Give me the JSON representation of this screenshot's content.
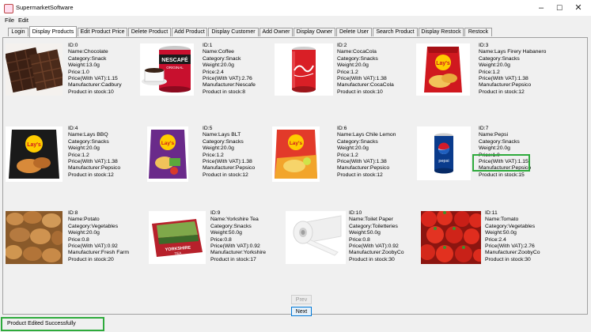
{
  "window": {
    "title": "SupermarketSoftware",
    "minimize_glyph": "–",
    "maximize_glyph": "☐",
    "close_glyph": "✕"
  },
  "menu": [
    "File",
    "Edit"
  ],
  "tabs": [
    {
      "label": "Login"
    },
    {
      "label": "Display Products",
      "active": true
    },
    {
      "label": "Edit Product Price"
    },
    {
      "label": "Delete Product"
    },
    {
      "label": "Add Product"
    },
    {
      "label": "Display Customer"
    },
    {
      "label": "Add Owner"
    },
    {
      "label": "Display Owner"
    },
    {
      "label": "Delete User"
    },
    {
      "label": "Search Product"
    },
    {
      "label": "Display Restock"
    },
    {
      "label": "Restock"
    }
  ],
  "products": [
    {
      "image": "chocolate",
      "lines": [
        "ID:0",
        "Name:Chocolate",
        "Category:Snack",
        "Weight:13.0g",
        "Price:1.0",
        "Price(With VAT):1.15",
        "Manufacturer:Cadbury",
        "Product in stock:10"
      ]
    },
    {
      "image": "coffee",
      "lines": [
        "ID:1",
        "Name:Coffee",
        "Category:Snack",
        "Weight:20.0g",
        "Price:2.4",
        "Price(With VAT):2.76",
        "Manufacturer:Nescafe",
        "Product in stock:8"
      ]
    },
    {
      "image": "cocacola",
      "lines": [
        "ID:2",
        "Name:CocaCola",
        "Category:Snacks",
        "Weight:20.0g",
        "Price:1.2",
        "Price(With VAT):1.38",
        "Manufacturer:CocaCola",
        "Product in stock:10"
      ]
    },
    {
      "image": "lays-red",
      "lines": [
        "ID:3",
        "Name:Lays Firery Habanero",
        "Category:Snacks",
        "Weight:20.0g",
        "Price:1.2",
        "Price(With VAT):1.38",
        "Manufacturer:Pepsico",
        "Product in stock:12"
      ]
    },
    {
      "image": "lays-bbq",
      "lines": [
        "ID:4",
        "Name:Lays BBQ",
        "Category:Snacks",
        "Weight:20.0g",
        "Price:1.2",
        "Price(With VAT):1.38",
        "Manufacturer:Pepsico",
        "Product in stock:12"
      ]
    },
    {
      "image": "lays-blt",
      "lines": [
        "ID:5",
        "Name:Lays BLT",
        "Category:Snacks",
        "Weight:20.0g",
        "Price:1.2",
        "Price(With VAT):1.38",
        "Manufacturer:Pepsico",
        "Product in stock:12"
      ]
    },
    {
      "image": "lays-chile",
      "lines": [
        "ID:6",
        "Name:Lays Chile Lemon",
        "Category:Snacks",
        "Weight:20.0g",
        "Price:1.2",
        "Price(With VAT):1.38",
        "Manufacturer:Pepsico",
        "Product in stock:12"
      ]
    },
    {
      "image": "pepsi",
      "lines": [
        "ID:7",
        "Name:Pepsi",
        "Category:Snacks",
        "Weight:20.0g",
        "Price:1.0",
        "Price(With VAT):1.15",
        "Manufacturer:Pepsico",
        "Product in stock:15"
      ]
    },
    {
      "image": "potato",
      "lines": [
        "ID:8",
        "Name:Potato",
        "Category:Vegetables",
        "Weight:20.0g",
        "Price:0.8",
        "Price(With VAT):0.92",
        "Manufacturer:Fresh Farm",
        "Product in stock:20"
      ]
    },
    {
      "image": "tea",
      "lines": [
        "ID:9",
        "Name:Yorkshire Tea",
        "Category:Snacks",
        "Weight:50.0g",
        "Price:0.8",
        "Price(With VAT):0.92",
        "Manufacturer:Yorkshire",
        "Product in stock:17"
      ]
    },
    {
      "image": "toilet-paper",
      "lines": [
        "ID:10",
        "Name:Toilet Paper",
        "Category:Toiletteries",
        "Weight:50.0g",
        "Price:0.8",
        "Price(With VAT):0.92",
        "Manufacturer:ZoobyCo",
        "Product in stock:30"
      ]
    },
    {
      "image": "tomato",
      "lines": [
        "ID:11",
        "Name:Tomato",
        "Category:Vegetables",
        "Weight:50.0g",
        "Price:2.4",
        "Price(With VAT):2.76",
        "Manufacturer:ZoobyCo",
        "Product in stock:30"
      ]
    }
  ],
  "packaging_text": {
    "nescafe": "NESCAFÉ",
    "nescafe_sub": "ORIGINAL",
    "lays": "Lay's",
    "pepsi": "pepsi",
    "yorkshire": "YORKSHIRE",
    "tea": "TEA"
  },
  "pagination": {
    "prev_label": "Prev",
    "prev_enabled": false,
    "next_label": "Next"
  },
  "status": {
    "message": "Product Edited Successfully"
  },
  "colors": {
    "highlight": "#2eaa3c",
    "focus": "#0078d7"
  }
}
